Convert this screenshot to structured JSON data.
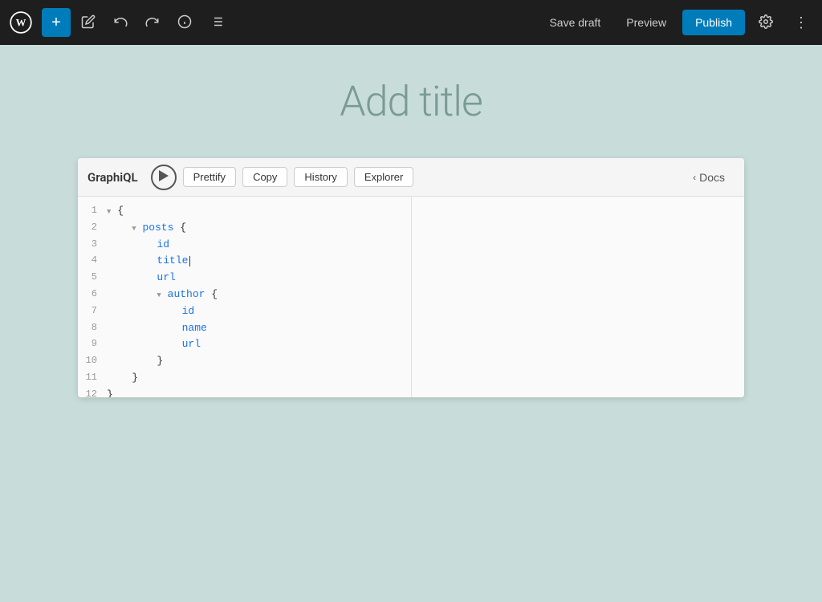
{
  "toolbar": {
    "wp_logo_alt": "WordPress",
    "add_label": "+",
    "edit_label": "✎",
    "undo_label": "↩",
    "redo_label": "↪",
    "info_label": "ℹ",
    "list_label": "≡",
    "save_draft_label": "Save draft",
    "preview_label": "Preview",
    "publish_label": "Publish",
    "settings_label": "⚙",
    "more_label": "⋮"
  },
  "content": {
    "title_placeholder": "Add title"
  },
  "graphiql": {
    "title": "GraphiQL",
    "prettify_label": "Prettify",
    "copy_label": "Copy",
    "history_label": "History",
    "explorer_label": "Explorer",
    "docs_label": "Docs",
    "code_lines": [
      {
        "num": "1",
        "indent": 0,
        "collapse": "▼",
        "content": "{"
      },
      {
        "num": "2",
        "indent": 1,
        "collapse": "▼",
        "content": "posts {"
      },
      {
        "num": "3",
        "indent": 2,
        "collapse": "",
        "content": "id"
      },
      {
        "num": "4",
        "indent": 2,
        "collapse": "",
        "content": "title"
      },
      {
        "num": "5",
        "indent": 2,
        "collapse": "",
        "content": "url"
      },
      {
        "num": "6",
        "indent": 2,
        "collapse": "▼",
        "content": "author {"
      },
      {
        "num": "7",
        "indent": 3,
        "collapse": "",
        "content": "id"
      },
      {
        "num": "8",
        "indent": 3,
        "collapse": "",
        "content": "name"
      },
      {
        "num": "9",
        "indent": 3,
        "collapse": "",
        "content": "url"
      },
      {
        "num": "10",
        "indent": 2,
        "collapse": "",
        "content": "}"
      },
      {
        "num": "11",
        "indent": 1,
        "collapse": "",
        "content": "}"
      },
      {
        "num": "12",
        "indent": 0,
        "collapse": "",
        "content": "}"
      }
    ]
  }
}
